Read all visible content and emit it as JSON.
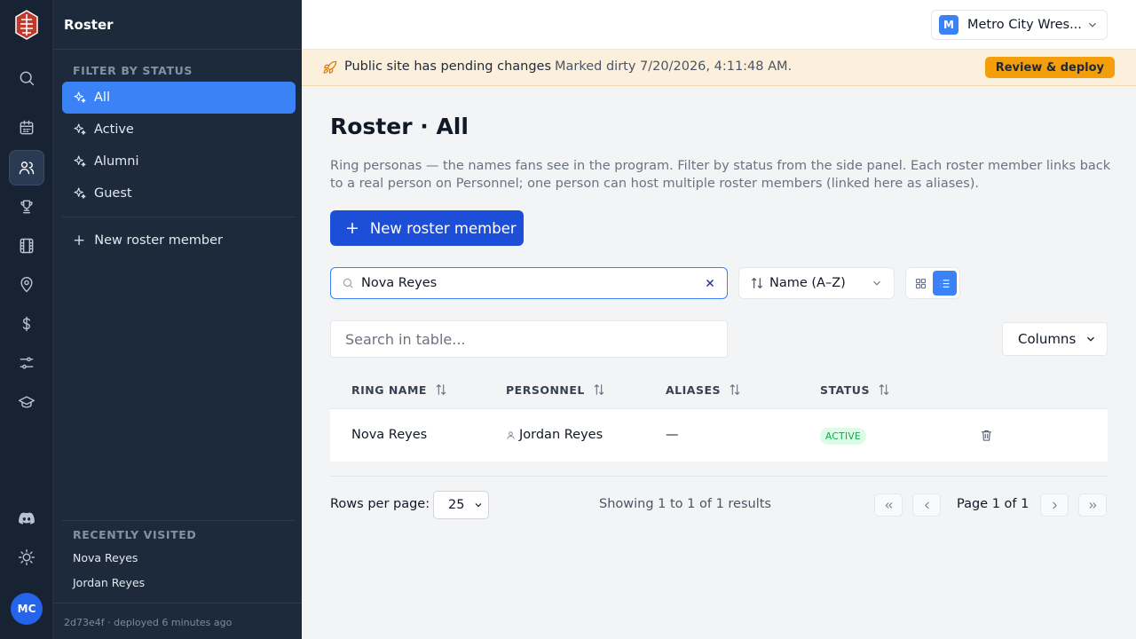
{
  "rail": {
    "items": [
      "search-icon",
      "calendar-icon",
      "users-icon",
      "trophy-icon",
      "film-icon",
      "map-pin-icon",
      "dollar-icon",
      "sliders-icon",
      "graduation-cap-icon"
    ],
    "active": "users-icon",
    "avatar_initials": "MC"
  },
  "sidebar": {
    "title": "Roster",
    "filter_heading": "FILTER BY STATUS",
    "filters": [
      {
        "label": "All",
        "active": true
      },
      {
        "label": "Active",
        "active": false
      },
      {
        "label": "Alumni",
        "active": false
      },
      {
        "label": "Guest",
        "active": false
      }
    ],
    "new_label": "New roster member",
    "recent_heading": "RECENTLY VISITED",
    "recent": [
      "Nova Reyes",
      "Jordan Reyes"
    ],
    "deploy_info": "2d73e4f · deployed 6 minutes ago"
  },
  "topbar": {
    "org_initial": "M",
    "org_name": "Metro City Wres..."
  },
  "banner": {
    "title": "Public site has pending changes",
    "subtitle": "Marked dirty 7/20/2026, 4:11:48 AM.",
    "button": "Review & deploy"
  },
  "main": {
    "title": "Roster · All",
    "description": "Ring personas — the names fans see in the program. Filter by status from the side panel. Each roster member links back to a real person on Personnel; one person can host multiple roster members (linked here as aliases).",
    "new_button": "New roster member",
    "search_value": "Nova Reyes",
    "sort_label": "Name (A–Z)",
    "table_search_placeholder": "Search in table...",
    "columns_button": "Columns",
    "headers": [
      "RING NAME",
      "PERSONNEL",
      "ALIASES",
      "STATUS"
    ],
    "rows": [
      {
        "ring_name": "Nova Reyes",
        "personnel": "Jordan Reyes",
        "aliases": "—",
        "status": "ACTIVE"
      }
    ],
    "rows_per_page_label": "Rows per page:",
    "rows_per_page": "25",
    "showing": "Showing 1 to 1 of 1 results",
    "page_info": "Page 1 of 1"
  },
  "colors": {
    "primary": "#1d4ed8",
    "accent": "#3b82f6",
    "warning": "#f59e0b",
    "success": "#16a34a",
    "sidebar_bg": "#1d2a3c",
    "rail_bg": "#172233"
  }
}
